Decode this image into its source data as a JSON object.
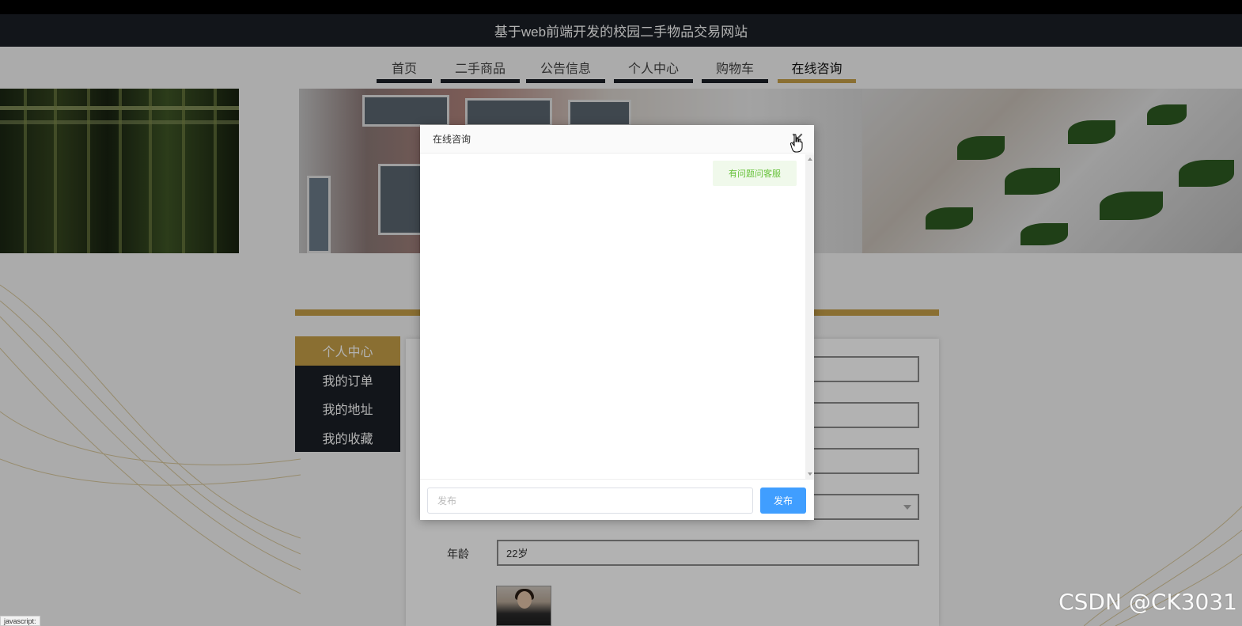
{
  "header": {
    "title": "基于web前端开发的校园二手物品交易网站"
  },
  "nav": {
    "items": [
      {
        "label": "首页"
      },
      {
        "label": "二手商品"
      },
      {
        "label": "公告信息"
      },
      {
        "label": "个人中心"
      },
      {
        "label": "购物车"
      },
      {
        "label": "在线咨询",
        "active": true
      }
    ]
  },
  "sidebar": {
    "items": [
      {
        "label": "个人中心",
        "active": true
      },
      {
        "label": "我的订单"
      },
      {
        "label": "我的地址"
      },
      {
        "label": "我的收藏"
      }
    ]
  },
  "form": {
    "age_label": "年龄",
    "age_value": "22岁"
  },
  "dialog": {
    "title": "在线咨询",
    "message": "有问题问客服",
    "input_placeholder": "发布",
    "send_label": "发布"
  },
  "watermark": "CSDN @CK3031",
  "status_bar": "javascript:",
  "colors": {
    "accent": "#c6a048",
    "dark": "#1b1f26",
    "primary": "#409eff",
    "bubble_text": "#67c23a"
  }
}
